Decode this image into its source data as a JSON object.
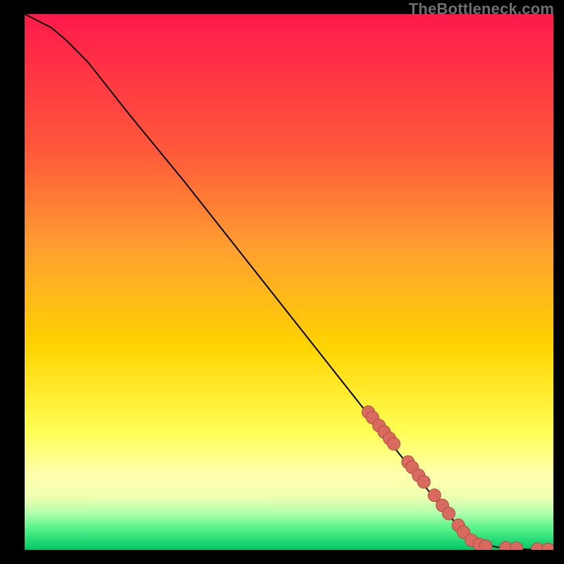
{
  "watermark": "TheBottleneck.com",
  "colors": {
    "gradient_top": "#ff1a4b",
    "gradient_mid1": "#ff7a2e",
    "gradient_mid2": "#ffd400",
    "gradient_pale": "#ffff9a",
    "gradient_green_light": "#8dff9a",
    "gradient_green": "#00d96b",
    "curve": "#000000",
    "marker_fill": "#d86a5f",
    "marker_stroke": "#b54a42",
    "frame": "#000000"
  },
  "chart_data": {
    "type": "line",
    "title": "",
    "xlabel": "",
    "ylabel": "",
    "xlim": [
      0,
      100
    ],
    "ylim": [
      0,
      100
    ],
    "curve": {
      "x": [
        0,
        2,
        5,
        8,
        12,
        20,
        30,
        40,
        50,
        60,
        70,
        80,
        85,
        88,
        90,
        92,
        95,
        100
      ],
      "y": [
        100,
        99,
        97.5,
        95,
        91,
        81,
        69,
        56.5,
        44,
        31.5,
        19,
        6.5,
        2,
        0.8,
        0.4,
        0.2,
        0.1,
        0.1
      ]
    },
    "markers": {
      "x": [
        65.0,
        65.8,
        67.0,
        68.0,
        69.0,
        69.8,
        72.5,
        73.3,
        74.5,
        75.5,
        77.5,
        79.0,
        80.2,
        82.0,
        83.0,
        84.5,
        86.0,
        87.2,
        91.0,
        93.0,
        97.0,
        99.0
      ],
      "y": [
        25.7,
        24.7,
        23.2,
        22.0,
        20.8,
        19.8,
        16.4,
        15.4,
        13.9,
        12.7,
        10.2,
        8.3,
        6.8,
        4.6,
        3.3,
        1.8,
        1.0,
        0.7,
        0.4,
        0.3,
        0.15,
        0.1
      ]
    },
    "gradient_bands": [
      {
        "stop": 0.0,
        "label": "red"
      },
      {
        "stop": 0.44,
        "label": "orange"
      },
      {
        "stop": 0.62,
        "label": "yellow"
      },
      {
        "stop": 0.83,
        "label": "pale-yellow"
      },
      {
        "stop": 0.92,
        "label": "light-green"
      },
      {
        "stop": 0.97,
        "label": "green"
      }
    ]
  }
}
